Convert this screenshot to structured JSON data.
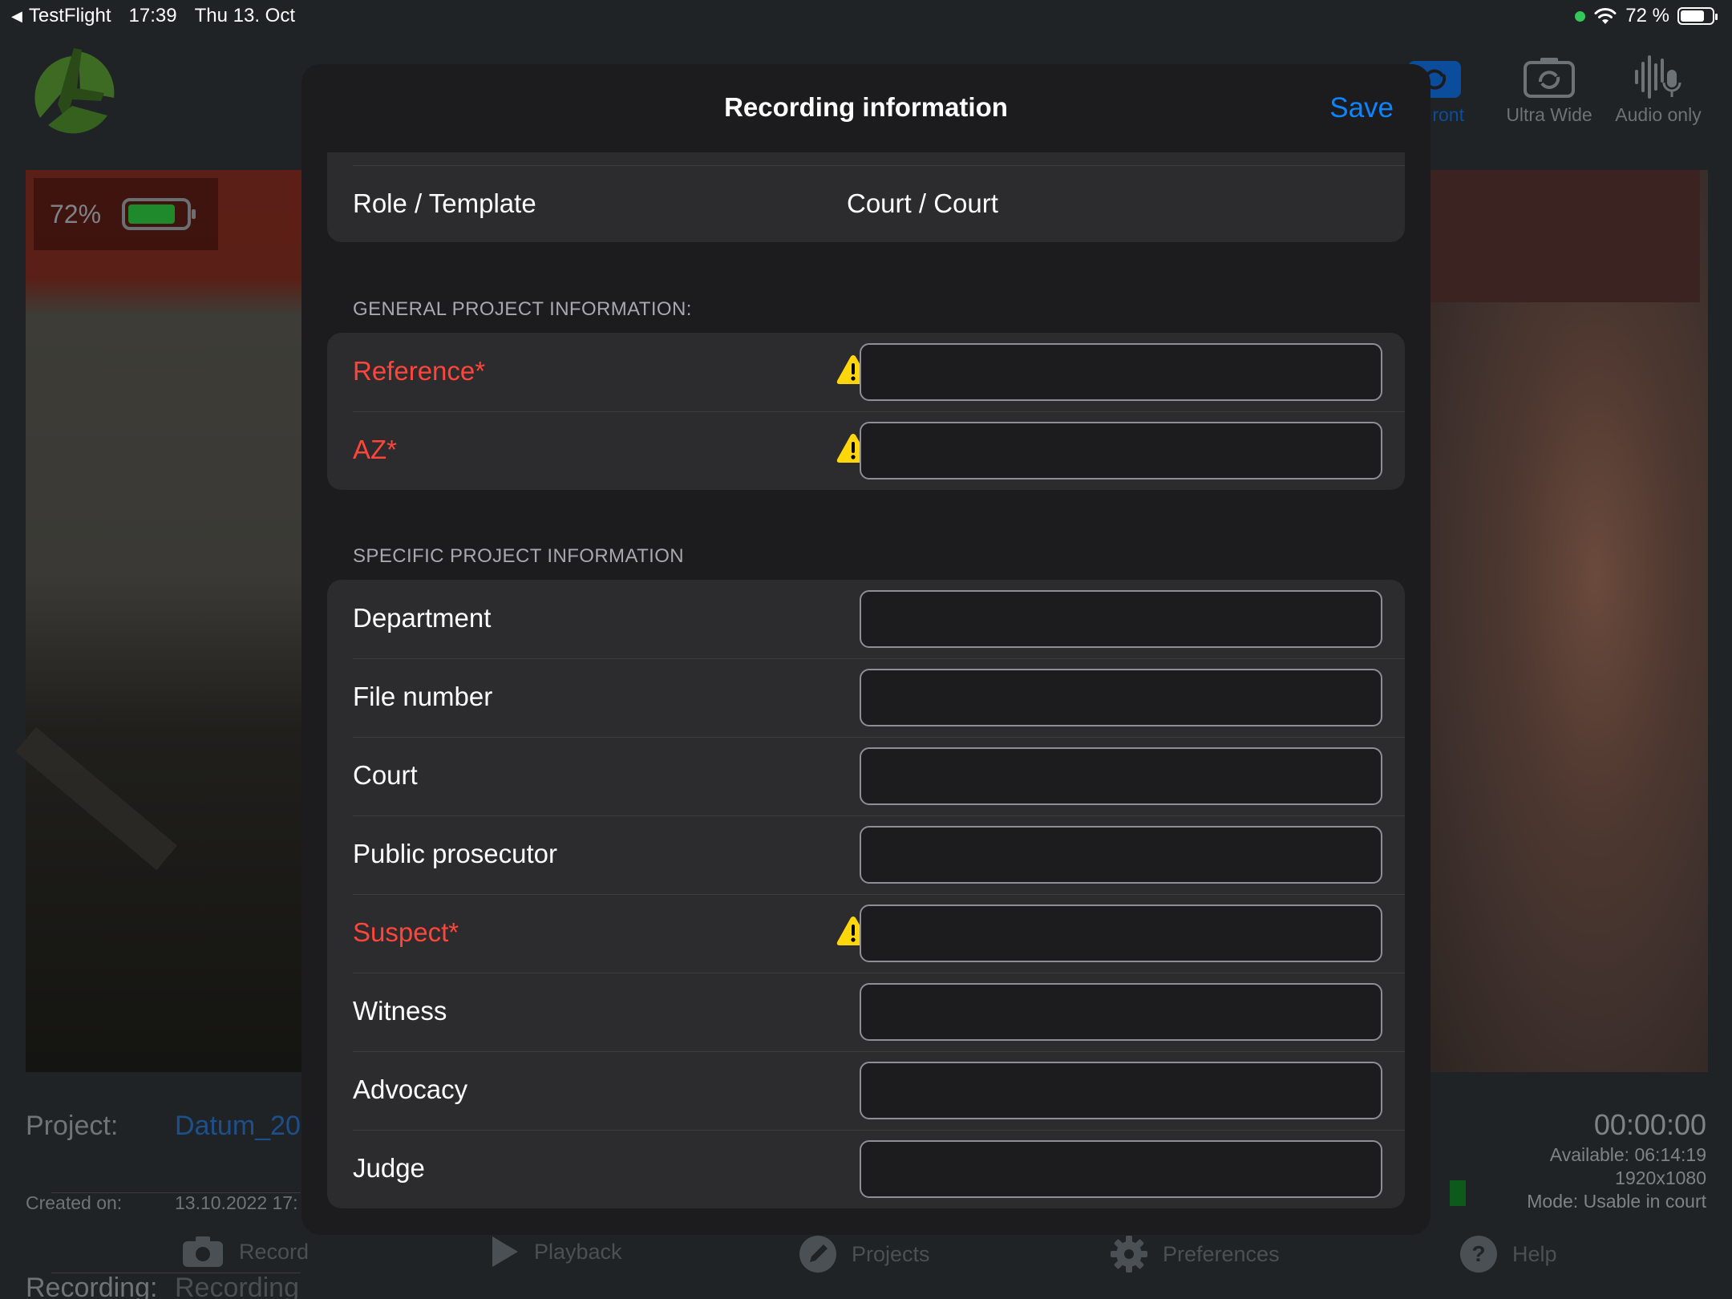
{
  "status_bar": {
    "back_app": "TestFlight",
    "time": "17:39",
    "date": "Thu 13. Oct",
    "battery": "72 %"
  },
  "camera_options": [
    {
      "label": "ront",
      "icon": "camera-rotate-icon",
      "active": true
    },
    {
      "label": "Ultra Wide",
      "icon": "camera-rotate-icon",
      "active": false
    },
    {
      "label": "Audio only",
      "icon": "microphone-waveform-icon",
      "active": false
    }
  ],
  "preview": {
    "battery_percent": "72%"
  },
  "project_info": {
    "project_label": "Project:",
    "project_value": "Datum_20",
    "created_label": "Created on:",
    "created_value": "13.10.2022 17:",
    "recording_label": "Recording:",
    "recording_value": "Recording"
  },
  "recording_status": {
    "timer": "00:00:00",
    "available": "Available: 06:14:19",
    "resolution": "1920x1080",
    "mode": "Mode: Usable in court"
  },
  "tabs": [
    {
      "label": "Record",
      "icon": "camera-icon"
    },
    {
      "label": "Playback",
      "icon": "play-icon"
    },
    {
      "label": "Projects",
      "icon": "pencil-icon"
    },
    {
      "label": "Preferences",
      "icon": "gear-icon"
    },
    {
      "label": "Help",
      "icon": "question-icon"
    }
  ],
  "modal": {
    "title": "Recording information",
    "save_label": "Save",
    "role_row": {
      "label": "Role / Template",
      "value": "Court / Court"
    },
    "general_section": {
      "header": "GENERAL PROJECT INFORMATION:",
      "fields": [
        {
          "label": "Reference*",
          "required": true,
          "value": ""
        },
        {
          "label": "AZ*",
          "required": true,
          "value": ""
        }
      ]
    },
    "specific_section": {
      "header": "SPECIFIC PROJECT INFORMATION",
      "fields": [
        {
          "label": "Department",
          "required": false,
          "value": ""
        },
        {
          "label": "File number",
          "required": false,
          "value": ""
        },
        {
          "label": "Court",
          "required": false,
          "value": ""
        },
        {
          "label": "Public prosecutor",
          "required": false,
          "value": ""
        },
        {
          "label": "Suspect*",
          "required": true,
          "value": ""
        },
        {
          "label": "Witness",
          "required": false,
          "value": ""
        },
        {
          "label": "Advocacy",
          "required": false,
          "value": ""
        },
        {
          "label": "Judge",
          "required": false,
          "value": ""
        }
      ]
    }
  },
  "colors": {
    "accent": "#0a84ff",
    "required": "#ff453a",
    "warning": "#ffd60a",
    "modal_bg": "#1c1c1e",
    "group_bg": "#2c2c2e"
  }
}
